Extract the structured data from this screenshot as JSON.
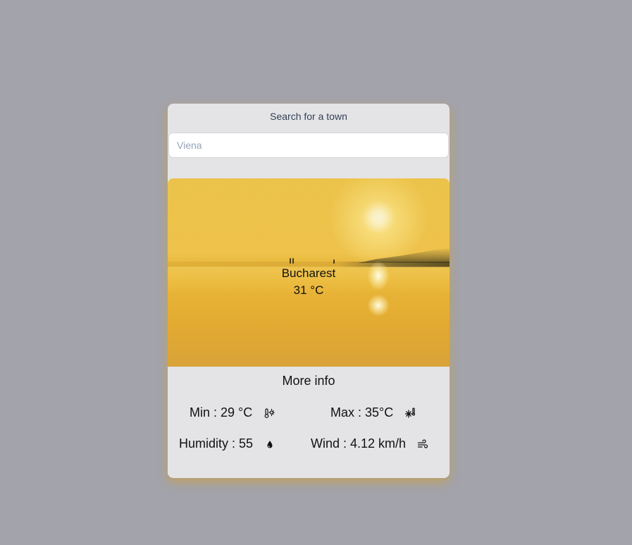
{
  "search": {
    "label": "Search for a town",
    "placeholder": "Viena",
    "value": ""
  },
  "weather": {
    "city": "Bucharest",
    "temperature": "31 °C"
  },
  "more_info": {
    "title": "More info",
    "stats": [
      {
        "label": "Min : 29 °C",
        "icon": "thermometer-sun-icon"
      },
      {
        "label": "Max : 35°C",
        "icon": "thermometer-snowflake-icon"
      },
      {
        "label": "Humidity : 55",
        "icon": "droplet-icon"
      },
      {
        "label": "Wind : 4.12 km/h",
        "icon": "wind-icon"
      }
    ]
  },
  "colors": {
    "background": "#a3a3ab",
    "card": "#e4e4e7",
    "accent_shadow": "#d69e28"
  }
}
